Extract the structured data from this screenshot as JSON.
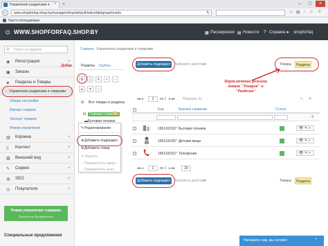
{
  "browser": {
    "tab_title": "Управление разделами и ...",
    "url": "www.shopforfaq.shop.by/manager/shop/default/index/tab/groupGoods",
    "search_placeholder": "",
    "bookmark_label": "Часто посещаемые"
  },
  "navbar": {
    "brand": "WWW.SHOPFORFAQ.SHOP.BY",
    "extensions": "Расширения",
    "news": "Новости",
    "help": "Справка",
    "shop": "shopforfaq"
  },
  "sidebar": {
    "search_placeholder": "Поиск по модулю",
    "items": [
      {
        "label": "Регистрация",
        "icon": "user-icon"
      },
      {
        "label": "Заказы",
        "icon": "cart-icon"
      },
      {
        "label": "Разделы и Товары",
        "icon": "tags-icon"
      },
      {
        "label": "Управление разделами и товарами",
        "icon": "chevron-right-icon"
      },
      {
        "label": "Общие настройки",
        "icon": ""
      },
      {
        "label": "Импорт товаров",
        "icon": ""
      },
      {
        "label": "Экспорт товаров",
        "icon": ""
      },
      {
        "label": "Режим управления",
        "icon": ""
      },
      {
        "label": "Корзина",
        "icon": "basket-icon"
      },
      {
        "label": "Контент",
        "icon": "file-icon"
      },
      {
        "label": "Внешний вид",
        "icon": "picture-icon"
      },
      {
        "label": "Сервис",
        "icon": "wrench-icon"
      },
      {
        "label": "SEO",
        "icon": "globe-icon"
      },
      {
        "label": "Покупатели",
        "icon": "users-icon"
      }
    ],
    "promo_title": "Режим управления товарами",
    "promo_sub": "Перейти на Профессионал",
    "special_offers": "Специальные предложения"
  },
  "breadcrumb": {
    "home": "Главная",
    "current": "Управление разделами и товарами"
  },
  "annotations": {
    "add_short": "Добав",
    "switch_note": "Переключение режима показа \"Товаров\" и \"Разделов\""
  },
  "tree": {
    "tab_sections": "Разделы",
    "tab_groups": "Группы",
    "row_all": "Все товары и разделы",
    "row_all2": "",
    "row_main": "Главная страница",
    "row_main_badge": "25",
    "row_item": "Бытовая техника"
  },
  "context_menu": {
    "items": [
      {
        "label": "Редактирование",
        "disabled": false
      },
      {
        "label": "Добавить подраздел",
        "disabled": false
      },
      {
        "label": "Добавить товар",
        "disabled": false
      },
      {
        "label": "Удалить",
        "disabled": true
      },
      {
        "label": "Переместить вверх",
        "disabled": true
      },
      {
        "label": "Переместить вниз",
        "disabled": true
      }
    ]
  },
  "toolbar": {
    "add_subsection": "Добавить подраздел",
    "actions": "Выберите действия",
    "products": "Товары",
    "sections": "Разделы"
  },
  "pager": {
    "top_label": "Показать по",
    "of": "из 1",
    "page": "1",
    "per_page": "20"
  },
  "table": {
    "headers": [
      "",
      "Код",
      "Краткое название",
      "Статус"
    ],
    "rows": [
      {
        "code": "1561161537",
        "name": "Бытовая техника",
        "thumb": "appliance"
      },
      {
        "code": "1561191457",
        "name": "Детские вещи",
        "thumb": "kids"
      },
      {
        "code": "1561191527",
        "name": "Телефония",
        "thumb": "phone"
      }
    ]
  },
  "chat": {
    "text": "Напишите нам, мы онлайн!"
  },
  "colors": {
    "navbar": "#353a40",
    "primary": "#2d6fa6",
    "success": "#5cb85c",
    "annotation": "#d03030"
  }
}
